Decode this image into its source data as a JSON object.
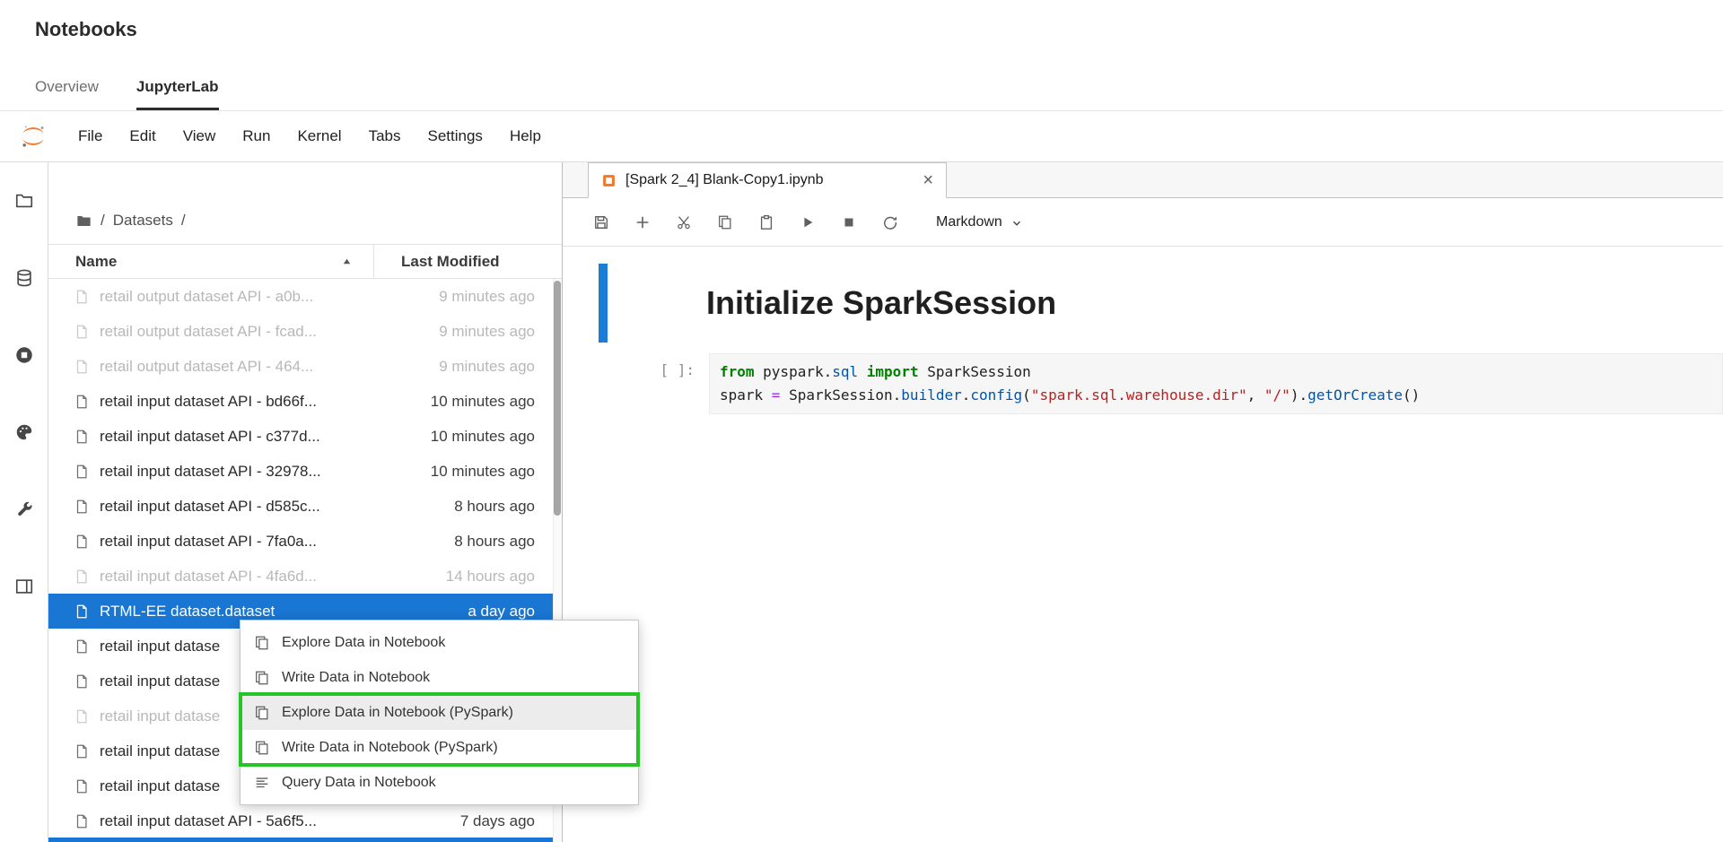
{
  "colors": {
    "jupyter_orange": "#f37726",
    "selection_blue": "#1976d2",
    "collapser_blue": "#1c7dd6",
    "highlight_green": "#27c427"
  },
  "header": {
    "title": "Notebooks",
    "tabs": [
      {
        "label": "Overview",
        "active": false
      },
      {
        "label": "JupyterLab",
        "active": true
      }
    ]
  },
  "menubar": {
    "items": [
      "File",
      "Edit",
      "View",
      "Run",
      "Kernel",
      "Tabs",
      "Settings",
      "Help"
    ]
  },
  "sidebar": {
    "icons": [
      {
        "name": "folder-icon"
      },
      {
        "name": "database-icon"
      },
      {
        "name": "running-sessions-icon"
      },
      {
        "name": "palette-icon"
      },
      {
        "name": "tools-icon"
      },
      {
        "name": "open-tabs-icon"
      }
    ]
  },
  "filebrowser": {
    "breadcrumb": {
      "segments": [
        "/",
        "Datasets",
        "/"
      ]
    },
    "columns": [
      {
        "label": "Name",
        "sort": "asc"
      },
      {
        "label": "Last Modified"
      }
    ],
    "rows": [
      {
        "name": "retail output dataset API - a0b...",
        "modified": "9 minutes ago",
        "dimmed": true,
        "selected": false
      },
      {
        "name": "retail output dataset API - fcad...",
        "modified": "9 minutes ago",
        "dimmed": true,
        "selected": false
      },
      {
        "name": "retail output dataset API - 464...",
        "modified": "9 minutes ago",
        "dimmed": true,
        "selected": false
      },
      {
        "name": "retail input dataset API - bd66f...",
        "modified": "10 minutes ago",
        "dimmed": false,
        "selected": false
      },
      {
        "name": "retail input dataset API - c377d...",
        "modified": "10 minutes ago",
        "dimmed": false,
        "selected": false
      },
      {
        "name": "retail input dataset API - 32978...",
        "modified": "10 minutes ago",
        "dimmed": false,
        "selected": false
      },
      {
        "name": "retail input dataset API - d585c...",
        "modified": "8 hours ago",
        "dimmed": false,
        "selected": false
      },
      {
        "name": "retail input dataset API - 7fa0a...",
        "modified": "8 hours ago",
        "dimmed": false,
        "selected": false
      },
      {
        "name": "retail input dataset API - 4fa6d...",
        "modified": "14 hours ago",
        "dimmed": true,
        "selected": false
      },
      {
        "name": "RTML-EE dataset.dataset",
        "modified": "a day ago",
        "dimmed": false,
        "selected": true
      },
      {
        "name": "retail input datase",
        "modified": "",
        "dimmed": false,
        "selected": false
      },
      {
        "name": "retail input datase",
        "modified": "",
        "dimmed": false,
        "selected": false
      },
      {
        "name": "retail input datase",
        "modified": "",
        "dimmed": true,
        "selected": false
      },
      {
        "name": "retail input datase",
        "modified": "",
        "dimmed": false,
        "selected": false
      },
      {
        "name": "retail input datase",
        "modified": "",
        "dimmed": false,
        "selected": false
      },
      {
        "name": "retail input dataset API - 5a6f5...",
        "modified": "7 days ago",
        "dimmed": false,
        "selected": false
      }
    ]
  },
  "contextmenu": {
    "items": [
      {
        "label": "Explore Data in Notebook",
        "icon": "copy-icon",
        "hover": false,
        "highlighted": false
      },
      {
        "label": "Write Data in Notebook",
        "icon": "copy-icon",
        "hover": false,
        "highlighted": false
      },
      {
        "label": "Explore Data in Notebook (PySpark)",
        "icon": "copy-icon",
        "hover": true,
        "highlighted": true
      },
      {
        "label": "Write Data in Notebook (PySpark)",
        "icon": "copy-icon",
        "hover": false,
        "highlighted": true
      },
      {
        "label": "Query Data in Notebook",
        "icon": "query-icon",
        "hover": false,
        "highlighted": false
      }
    ]
  },
  "notebook": {
    "tab": {
      "title": "[Spark 2_4] Blank-Copy1.ipynb",
      "close": "×"
    },
    "toolbar": {
      "buttons": [
        "save",
        "insert",
        "cut",
        "copy",
        "paste",
        "run",
        "stop",
        "restart"
      ],
      "cell_type": "Markdown"
    },
    "cells": {
      "markdown": {
        "heading": "Initialize SparkSession"
      },
      "code": {
        "prompt": "[ ]:",
        "lines": [
          [
            {
              "t": "from",
              "c": "kw"
            },
            {
              "t": " pyspark.",
              "c": "pl"
            },
            {
              "t": "sql",
              "c": "prop"
            },
            {
              "t": " ",
              "c": "pl"
            },
            {
              "t": "import",
              "c": "kw"
            },
            {
              "t": " SparkSession",
              "c": "pl"
            }
          ],
          [
            {
              "t": "spark ",
              "c": "pl"
            },
            {
              "t": "=",
              "c": "op"
            },
            {
              "t": " SparkSession.",
              "c": "pl"
            },
            {
              "t": "builder",
              "c": "prop"
            },
            {
              "t": ".",
              "c": "pl"
            },
            {
              "t": "config",
              "c": "prop"
            },
            {
              "t": "(",
              "c": "pl"
            },
            {
              "t": "\"spark.sql.warehouse.dir\"",
              "c": "str"
            },
            {
              "t": ", ",
              "c": "pl"
            },
            {
              "t": "\"/\"",
              "c": "str"
            },
            {
              "t": ").",
              "c": "pl"
            },
            {
              "t": "getOrCreate",
              "c": "prop"
            },
            {
              "t": "()",
              "c": "pl"
            }
          ]
        ]
      }
    }
  }
}
